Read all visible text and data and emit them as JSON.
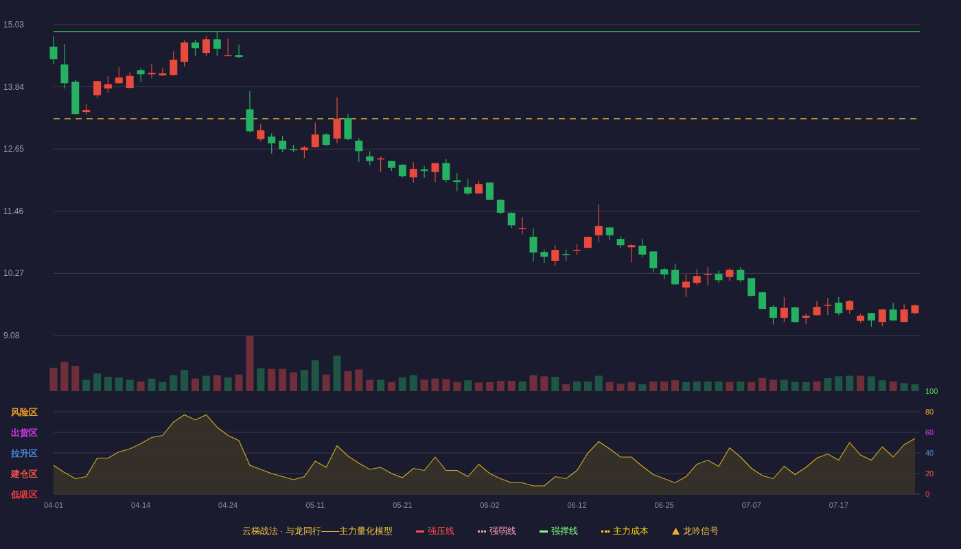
{
  "main_chart": {
    "chart_data": {
      "type": "candlestick",
      "categories": [
        null,
        null,
        null,
        null,
        null,
        null,
        null,
        null,
        null,
        null,
        null,
        null,
        null,
        null,
        null,
        null,
        null,
        null,
        null,
        null,
        null,
        null,
        null,
        null,
        null,
        null,
        null,
        null,
        null,
        null,
        null,
        null,
        null,
        null,
        null,
        null,
        null,
        null,
        null,
        null,
        null,
        null,
        null,
        null,
        null,
        null,
        null,
        null,
        null,
        null,
        null,
        null,
        null,
        null,
        null,
        null,
        null,
        null,
        null,
        null,
        null,
        null,
        null,
        null,
        null,
        null,
        null,
        null,
        null,
        null,
        null,
        null,
        null,
        null,
        null,
        null,
        null,
        null,
        null,
        null
      ],
      "ohlc": [
        [
          14.61,
          14.81,
          14.28,
          14.37
        ],
        [
          14.27,
          14.66,
          13.81,
          13.91
        ],
        [
          13.94,
          13.98,
          13.31,
          13.32
        ],
        [
          13.36,
          13.51,
          13.31,
          13.4
        ],
        [
          13.68,
          13.95,
          13.62,
          13.95
        ],
        [
          13.81,
          14.05,
          13.73,
          13.89
        ],
        [
          13.91,
          14.22,
          13.9,
          14.02
        ],
        [
          13.82,
          14.12,
          13.81,
          14.05
        ],
        [
          14.16,
          14.2,
          13.93,
          14.08
        ],
        [
          14.08,
          14.28,
          14.01,
          14.11
        ],
        [
          14.06,
          14.2,
          14.05,
          14.1
        ],
        [
          14.07,
          14.52,
          14.05,
          14.36
        ],
        [
          14.32,
          14.73,
          14.23,
          14.69
        ],
        [
          14.69,
          14.74,
          14.43,
          14.58
        ],
        [
          14.49,
          14.81,
          14.43,
          14.75
        ],
        [
          14.75,
          14.89,
          14.43,
          14.57
        ],
        [
          14.44,
          14.77,
          14.44,
          14.45
        ],
        [
          14.45,
          14.65,
          14.39,
          14.41
        ],
        [
          13.41,
          13.76,
          12.97,
          12.99
        ],
        [
          12.84,
          13.13,
          12.8,
          13.01
        ],
        [
          12.89,
          12.95,
          12.56,
          12.76
        ],
        [
          12.81,
          12.9,
          12.59,
          12.65
        ],
        [
          12.65,
          12.73,
          12.59,
          12.63
        ],
        [
          12.63,
          12.71,
          12.48,
          12.68
        ],
        [
          12.69,
          13.16,
          12.68,
          12.93
        ],
        [
          12.93,
          12.95,
          12.71,
          12.73
        ],
        [
          12.85,
          13.64,
          12.76,
          13.23
        ],
        [
          13.24,
          13.32,
          12.82,
          12.84
        ],
        [
          12.81,
          12.86,
          12.4,
          12.61
        ],
        [
          12.51,
          12.61,
          12.34,
          12.42
        ],
        [
          12.46,
          12.51,
          12.21,
          12.47
        ],
        [
          12.42,
          12.42,
          12.23,
          12.29
        ],
        [
          12.35,
          12.36,
          12.11,
          12.13
        ],
        [
          12.11,
          12.4,
          12.01,
          12.27
        ],
        [
          12.26,
          12.32,
          12.1,
          12.23
        ],
        [
          12.21,
          12.38,
          12.02,
          12.38
        ],
        [
          12.38,
          12.46,
          12.01,
          12.06
        ],
        [
          12.05,
          12.19,
          11.84,
          12.02
        ],
        [
          11.92,
          12.07,
          11.77,
          11.8
        ],
        [
          11.8,
          12.04,
          11.79,
          11.98
        ],
        [
          12.01,
          12.01,
          11.67,
          11.68
        ],
        [
          11.68,
          11.69,
          11.4,
          11.43
        ],
        [
          11.43,
          11.44,
          11.14,
          11.19
        ],
        [
          11.12,
          11.35,
          11.02,
          11.14
        ],
        [
          10.97,
          11.13,
          10.5,
          10.67
        ],
        [
          10.68,
          10.73,
          10.47,
          10.59
        ],
        [
          10.51,
          10.81,
          10.42,
          10.72
        ],
        [
          10.64,
          10.73,
          10.51,
          10.63
        ],
        [
          10.71,
          10.83,
          10.62,
          10.72
        ],
        [
          10.76,
          10.98,
          10.75,
          10.97
        ],
        [
          11.0,
          11.59,
          10.87,
          11.18
        ],
        [
          11.15,
          11.15,
          10.91,
          11.0
        ],
        [
          10.93,
          10.98,
          10.76,
          10.81
        ],
        [
          10.77,
          10.83,
          10.48,
          10.81
        ],
        [
          10.8,
          10.93,
          10.58,
          10.63
        ],
        [
          10.69,
          10.69,
          10.29,
          10.37
        ],
        [
          10.35,
          10.38,
          10.16,
          10.25
        ],
        [
          10.34,
          10.46,
          10.05,
          10.06
        ],
        [
          10.0,
          10.26,
          9.82,
          10.11
        ],
        [
          10.09,
          10.35,
          10.05,
          10.22
        ],
        [
          10.24,
          10.39,
          10.04,
          10.26
        ],
        [
          10.26,
          10.33,
          10.09,
          10.14
        ],
        [
          10.2,
          10.37,
          10.13,
          10.34
        ],
        [
          10.34,
          10.39,
          10.1,
          10.14
        ],
        [
          10.18,
          10.18,
          9.83,
          9.84
        ],
        [
          9.91,
          9.92,
          9.59,
          9.59
        ],
        [
          9.63,
          9.67,
          9.29,
          9.42
        ],
        [
          9.42,
          9.82,
          9.34,
          9.61
        ],
        [
          9.62,
          9.63,
          9.33,
          9.34
        ],
        [
          9.42,
          9.5,
          9.3,
          9.46
        ],
        [
          9.47,
          9.74,
          9.46,
          9.63
        ],
        [
          9.66,
          9.8,
          9.47,
          9.67
        ],
        [
          9.71,
          9.82,
          9.47,
          9.51
        ],
        [
          9.57,
          9.76,
          9.5,
          9.74
        ],
        [
          9.36,
          9.5,
          9.32,
          9.46
        ],
        [
          9.51,
          9.51,
          9.25,
          9.37
        ],
        [
          9.34,
          9.59,
          9.26,
          9.58
        ],
        [
          9.58,
          9.71,
          9.36,
          9.37
        ],
        [
          9.34,
          9.68,
          9.34,
          9.58
        ],
        [
          9.51,
          9.67,
          9.49,
          9.66
        ]
      ],
      "ylim": [
        9.08,
        15.03
      ],
      "grid": true,
      "ref_lines": [
        {
          "axis": "y",
          "value": 14.9,
          "color": "#3fa34d"
        },
        {
          "axis": "y",
          "value": 13.23,
          "color": "#e0c030"
        }
      ],
      "yticks": [
        15.03,
        13.84,
        12.65,
        11.46,
        10.27,
        9.08
      ]
    }
  },
  "indicator": {
    "zones": [
      {
        "label": "风险区",
        "color": "#f5a623"
      },
      {
        "label": "出货区",
        "color": "#e040fb"
      },
      {
        "label": "拉升区",
        "color": "#4a90e2"
      },
      {
        "label": "建仓区",
        "color": "#ff5a4a"
      },
      {
        "label": "低吸区",
        "color": "#ff4040"
      }
    ],
    "chart_data": {
      "type": "area",
      "categories": [
        "04-01",
        null,
        null,
        null,
        null,
        null,
        null,
        null,
        "04-14",
        null,
        null,
        null,
        null,
        null,
        null,
        null,
        "04-24",
        null,
        null,
        null,
        null,
        null,
        null,
        null,
        "05-11",
        null,
        null,
        null,
        null,
        null,
        null,
        null,
        "05-21",
        null,
        null,
        null,
        null,
        null,
        null,
        null,
        "06-02",
        null,
        null,
        null,
        null,
        null,
        null,
        null,
        "06-12",
        null,
        null,
        null,
        null,
        null,
        null,
        null,
        "06-25",
        null,
        null,
        null,
        null,
        null,
        null,
        null,
        "07-07",
        null,
        null,
        null,
        null,
        null,
        null,
        null,
        "07-17",
        null,
        null,
        null,
        null,
        null,
        null,
        null
      ],
      "series": [
        {
          "color": "#d4b020",
          "values": [
            28,
            21,
            15,
            17,
            35,
            35,
            41,
            44,
            49,
            55,
            57,
            70,
            77,
            72,
            77,
            65,
            57,
            52,
            28,
            24,
            20,
            17,
            14,
            17,
            32,
            26,
            47,
            37,
            30,
            24,
            26,
            20,
            16,
            25,
            23,
            36,
            23,
            23,
            17,
            29,
            20,
            15,
            11,
            11,
            8,
            8,
            17,
            15,
            23,
            40,
            51,
            44,
            36,
            36,
            27,
            19,
            15,
            11,
            17,
            29,
            33,
            27,
            45,
            36,
            25,
            18,
            15,
            27,
            19,
            26,
            35,
            39,
            33,
            50,
            38,
            33,
            46,
            36,
            48,
            54
          ]
        }
      ],
      "ylim": [
        0,
        100
      ],
      "yticks": [
        0,
        20,
        40,
        60,
        80,
        100
      ],
      "grid": true
    }
  },
  "legend": {
    "title": "云梯战法 · 与龙同行——主力量化模型",
    "items": [
      {
        "label": "强压线",
        "color": "#ff4d4f",
        "kind": "solid"
      },
      {
        "label": "强弱线",
        "color": "#ff9db0",
        "kind": "dashed"
      },
      {
        "label": "强撑线",
        "color": "#7dff7d",
        "kind": "solid"
      },
      {
        "label": "主力成本",
        "color": "#ffd700",
        "kind": "dashed"
      },
      {
        "label": "龙吟信号",
        "color": "#f5b030",
        "kind": "triangle"
      }
    ]
  }
}
